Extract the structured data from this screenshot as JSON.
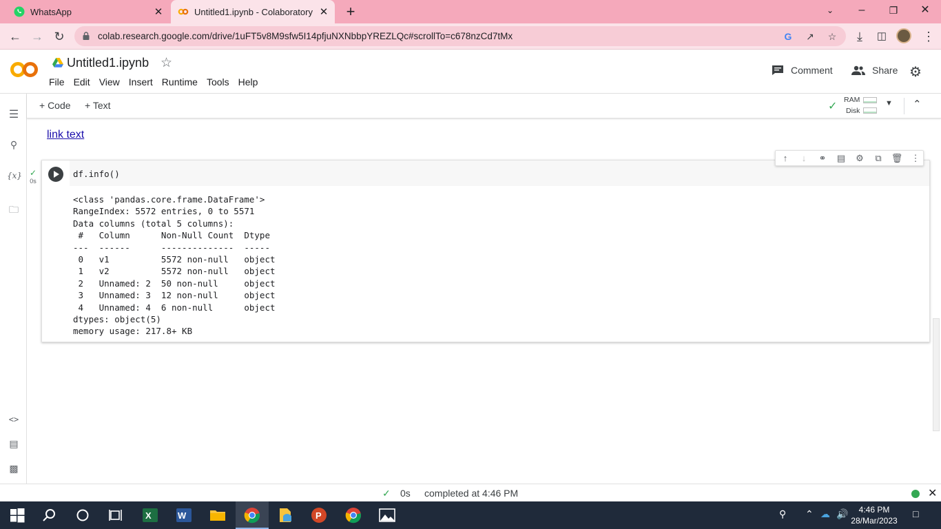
{
  "browser": {
    "tabs": [
      {
        "label": "WhatsApp",
        "icon": "whatsapp-icon",
        "close": "✕"
      },
      {
        "label": "Untitled1.ipynb - Colaboratory",
        "icon": "colab-icon",
        "close": "✕"
      }
    ],
    "new_tab": "+",
    "url": "colab.research.google.com/drive/1uFT5v8M9sfw5I14pfjuNXNbbpYREZLQc#scrollTo=c678nzCd7tMx"
  },
  "colab": {
    "title": "Untitled1.ipynb",
    "menu": [
      "File",
      "Edit",
      "View",
      "Insert",
      "Runtime",
      "Tools",
      "Help"
    ],
    "comment_label": "Comment",
    "share_label": "Share",
    "toolbar": {
      "code_label": "+ Code",
      "text_label": "+ Text"
    },
    "resources": {
      "ram_label": "RAM",
      "disk_label": "Disk"
    }
  },
  "notebook": {
    "link_text": "link text",
    "cell": {
      "code": "df.info()",
      "exec_time": "0s",
      "output": "<class 'pandas.core.frame.DataFrame'>\nRangeIndex: 5572 entries, 0 to 5571\nData columns (total 5 columns):\n #   Column      Non-Null Count  Dtype \n---  ------      --------------  ----- \n 0   v1          5572 non-null   object\n 1   v2          5572 non-null   object\n 2   Unnamed: 2  50 non-null     object\n 3   Unnamed: 3  12 non-null     object\n 4   Unnamed: 4  6 non-null      object\ndtypes: object(5)\nmemory usage: 217.8+ KB"
    }
  },
  "status": {
    "check": "✓",
    "duration": "0s",
    "message": "completed at 4:46 PM"
  },
  "taskbar": {
    "time": "4:46 PM",
    "date": "28/Mar/2023"
  },
  "colors": {
    "tab_bar": "#f5a9bb",
    "active_tab": "#fbe3e9",
    "link": "#1a0dab",
    "success": "#34a853",
    "taskbar": "#1f2a3a",
    "colab_orange": "#f9ab00"
  }
}
